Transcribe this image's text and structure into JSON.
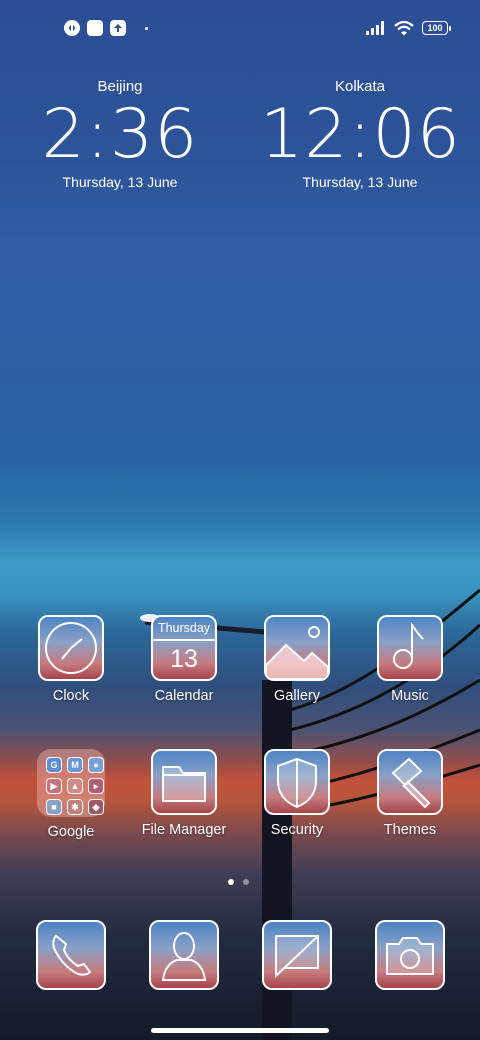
{
  "status_bar": {
    "battery": "100",
    "left_icons": [
      "app-notification-icon",
      "square-notification-icon",
      "upload-notification-icon"
    ],
    "right_icons": [
      "signal-icon",
      "wifi-icon",
      "battery-icon"
    ]
  },
  "clocks": [
    {
      "city": "Beijing",
      "time": "2:36",
      "date": "Thursday, 13 June"
    },
    {
      "city": "Kolkata",
      "time": "12:06",
      "date": "Thursday, 13 June"
    }
  ],
  "apps_row1": [
    {
      "label": "Clock",
      "icon": "clock-icon"
    },
    {
      "label": "Calendar",
      "icon": "calendar-icon",
      "day": "Thursday",
      "num": "13"
    },
    {
      "label": "Gallery",
      "icon": "gallery-icon"
    },
    {
      "label": "Music",
      "icon": "music-note-icon"
    }
  ],
  "apps_row2": [
    {
      "label": "Google",
      "icon": "google-folder-icon"
    },
    {
      "label": "File Manager",
      "icon": "folder-icon"
    },
    {
      "label": "Security",
      "icon": "shield-icon"
    },
    {
      "label": "Themes",
      "icon": "paintbrush-icon"
    }
  ],
  "dock": [
    {
      "icon": "phone-icon"
    },
    {
      "icon": "contacts-icon"
    },
    {
      "icon": "messages-icon"
    },
    {
      "icon": "camera-icon"
    }
  ],
  "pages": {
    "count": 2,
    "active": 0
  },
  "colors": {
    "tile_top": "#4f83c3",
    "tile_bottom": "#a5444a",
    "accent": "#ffffff"
  }
}
